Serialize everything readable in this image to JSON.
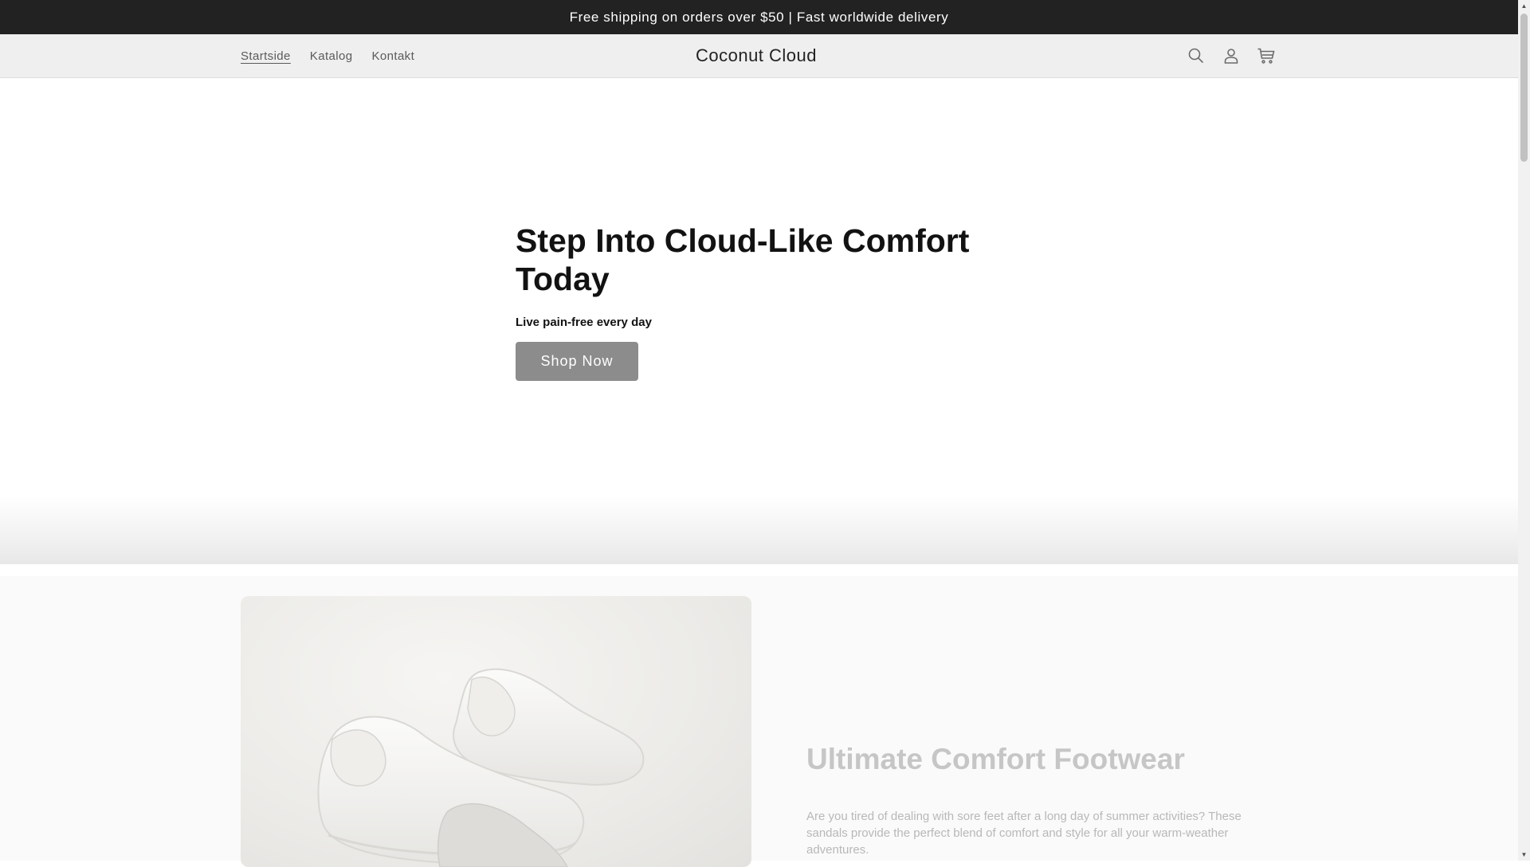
{
  "announcement": {
    "text": "Free shipping on orders over $50 | Fast worldwide delivery"
  },
  "header": {
    "nav": [
      {
        "label": "Startside",
        "active": true
      },
      {
        "label": "Katalog",
        "active": false
      },
      {
        "label": "Kontakt",
        "active": false
      }
    ],
    "logo": "Coconut Cloud",
    "icons": [
      "search-icon",
      "account-icon",
      "cart-icon"
    ]
  },
  "hero": {
    "title": "Step Into Cloud-Like Comfort Today",
    "subtitle": "Live pain-free every day",
    "button_label": "Shop Now"
  },
  "feature": {
    "title": "Ultimate Comfort Footwear",
    "description": "Are you tired of dealing with sore feet after a long day of summer activities? These sandals provide the perfect blend of comfort and style for all your warm-weather adventures."
  },
  "colors": {
    "announcement_bg": "#222222",
    "header_bg": "#efefef",
    "button_bg": "#8c8c8c",
    "faded_text": "#c6c6c6"
  }
}
